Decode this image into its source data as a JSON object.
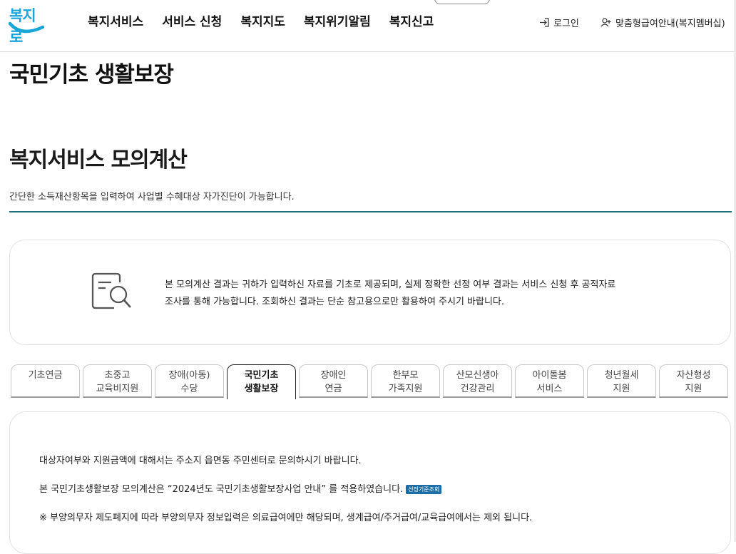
{
  "header": {
    "logo": "복지로",
    "nav": [
      "복지서비스",
      "서비스 신청",
      "복지지도",
      "복지위기알림",
      "복지신고"
    ],
    "login": "로그인",
    "membership": "맞춤형급여안내(복지멤버십)"
  },
  "page": {
    "title": "국민기초 생활보장",
    "section_title": "복지서비스 모의계산",
    "section_desc": "간단한 소득재산항목을 입력하여 사업별 수혜대상 자가진단이 가능합니다."
  },
  "notice": {
    "line1": "본 모의계산 결과는 귀하가 입력하신 자료를 기초로 제공되며, 실제 정확한 선정 여부 결과는 서비스 신청 후 공적자료",
    "line2": "조사를 통해 가능합니다. 조회하신 결과는 단순 참고용으로만 활용하여 주시기 바랍니다."
  },
  "tabs": [
    {
      "l1": "기초연금",
      "l2": ""
    },
    {
      "l1": "초중고",
      "l2": "교육비지원"
    },
    {
      "l1": "장애(아동)",
      "l2": "수당"
    },
    {
      "l1": "국민기초",
      "l2": "생활보장"
    },
    {
      "l1": "장애인",
      "l2": "연금"
    },
    {
      "l1": "한부모",
      "l2": "가족지원"
    },
    {
      "l1": "산모신생아",
      "l2": "건강관리"
    },
    {
      "l1": "아이돌봄",
      "l2": "서비스"
    },
    {
      "l1": "청년월세",
      "l2": "지원"
    },
    {
      "l1": "자산형성",
      "l2": "지원"
    }
  ],
  "active_tab": 3,
  "content": {
    "line1": "대상자여부와 지원금액에 대해서는 주소지 읍면동 주민센터로 문의하시기 바랍니다.",
    "line2": "본 국민기초생활보장 모의계산은 “2024년도 국민기초생활보장사업 안내” 를 적용하였습니다.",
    "badge": "선정기준조회",
    "line3": "※ 부양의무자 제도폐지에 따라 부양의무자 정보입력은 의료급여에만 해당되며, 생계급여/주거급여/교육급여에서는 제외 됩니다."
  },
  "colors": {
    "brand": "#1aa5d8",
    "accent": "#1c6f7e",
    "badge": "#1b6ea5"
  }
}
